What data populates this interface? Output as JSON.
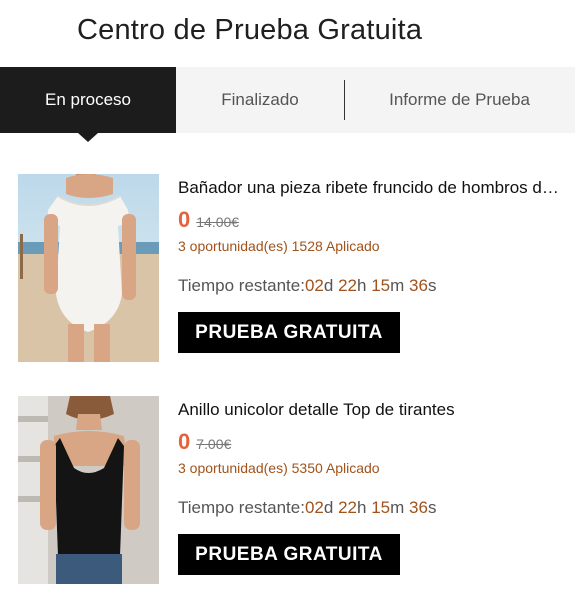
{
  "page": {
    "title": "Centro de Prueba Gratuita"
  },
  "tabs": [
    {
      "label": "En proceso",
      "active": true
    },
    {
      "label": "Finalizado",
      "active": false
    },
    {
      "label": "Informe de Prueba",
      "active": false
    }
  ],
  "colors": {
    "price": "#e4633c",
    "accent": "#a0531c",
    "button_bg": "#000000",
    "active_tab": "#1c1c1c"
  },
  "products": [
    {
      "name": "Bañador una pieza ribete fruncido de hombros descubiertos",
      "price": "0",
      "original_price": "14.00€",
      "applied_text": "3 oportunidad(es) 1528 Aplicado",
      "timer_label": "Tiempo restante:",
      "days": "02",
      "days_unit": "d",
      "hours": "22",
      "hours_unit": "h",
      "minutes": "15",
      "minutes_unit": "m",
      "seconds": "36",
      "seconds_unit": "s",
      "button_label": "PRUEBA GRATUITA"
    },
    {
      "name": "Anillo unicolor detalle Top de tirantes",
      "price": "0",
      "original_price": "7.00€",
      "applied_text": "3 oportunidad(es) 5350 Aplicado",
      "timer_label": "Tiempo restante:",
      "days": "02",
      "days_unit": "d",
      "hours": "22",
      "hours_unit": "h",
      "minutes": "15",
      "minutes_unit": "m",
      "seconds": "36",
      "seconds_unit": "s",
      "button_label": "PRUEBA GRATUITA"
    }
  ]
}
